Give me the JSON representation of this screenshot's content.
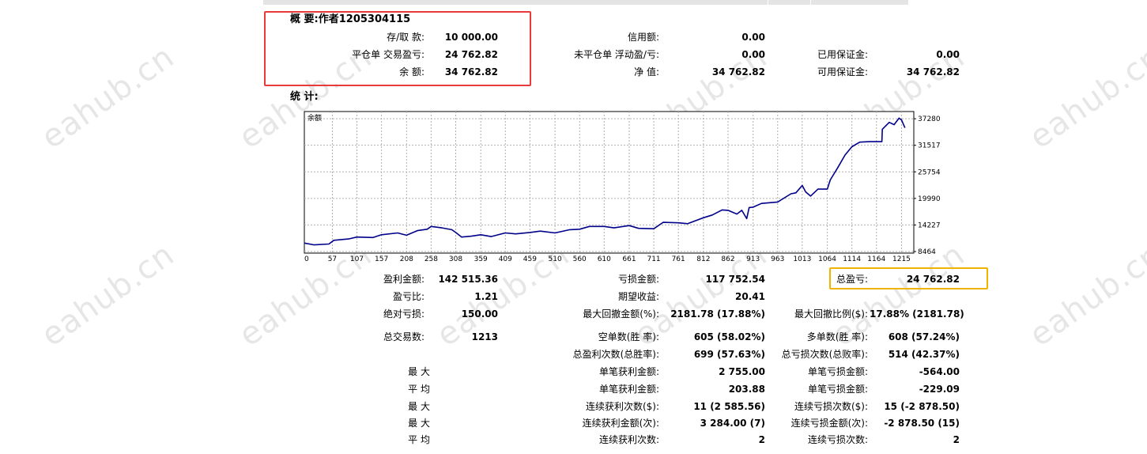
{
  "watermark": "eahub.cn",
  "summary": {
    "title": "概 要:作者1205304115",
    "rows": [
      {
        "l1": "存/取 款:",
        "v1": "10 000.00",
        "l2": "信用额:",
        "v2": "0.00",
        "l3": "",
        "v3": ""
      },
      {
        "l1": "平仓单 交易盈亏:",
        "v1": "24 762.82",
        "l2": "未平仓单 浮动盈/亏:",
        "v2": "0.00",
        "l3": "已用保证金:",
        "v3": "0.00"
      },
      {
        "l1": "余 额:",
        "v1": "34 762.82",
        "l2": "净 值:",
        "v2": "34 762.82",
        "l3": "可用保证金:",
        "v3": "34 762.82"
      }
    ]
  },
  "stats_title": "统 计:",
  "chart_data": {
    "type": "line",
    "title": "余额",
    "x": [
      0,
      57,
      107,
      157,
      208,
      258,
      308,
      359,
      409,
      459,
      510,
      560,
      610,
      661,
      711,
      761,
      812,
      862,
      913,
      963,
      1013,
      1064,
      1114,
      1164,
      1215
    ],
    "xlim": [
      0,
      1240
    ],
    "ylim": [
      8464,
      38500
    ],
    "y_ticks": [
      37280,
      31517,
      25754,
      19990,
      14227,
      8464
    ],
    "grid": true,
    "series": [
      {
        "color": "#00008b",
        "points": [
          [
            0,
            10300
          ],
          [
            20,
            9900
          ],
          [
            50,
            10100
          ],
          [
            60,
            10900
          ],
          [
            90,
            11200
          ],
          [
            107,
            11600
          ],
          [
            140,
            11500
          ],
          [
            157,
            12100
          ],
          [
            190,
            12500
          ],
          [
            208,
            12000
          ],
          [
            230,
            13000
          ],
          [
            250,
            13300
          ],
          [
            258,
            13900
          ],
          [
            280,
            13600
          ],
          [
            300,
            13200
          ],
          [
            308,
            12600
          ],
          [
            320,
            11600
          ],
          [
            340,
            11800
          ],
          [
            359,
            12100
          ],
          [
            380,
            11700
          ],
          [
            409,
            12500
          ],
          [
            430,
            12300
          ],
          [
            459,
            12600
          ],
          [
            480,
            12900
          ],
          [
            510,
            12500
          ],
          [
            540,
            13200
          ],
          [
            560,
            13300
          ],
          [
            580,
            13900
          ],
          [
            610,
            13900
          ],
          [
            630,
            13600
          ],
          [
            661,
            14100
          ],
          [
            680,
            13500
          ],
          [
            711,
            13400
          ],
          [
            730,
            14800
          ],
          [
            761,
            14700
          ],
          [
            780,
            14500
          ],
          [
            812,
            15800
          ],
          [
            830,
            16400
          ],
          [
            850,
            17500
          ],
          [
            862,
            17400
          ],
          [
            880,
            16600
          ],
          [
            890,
            17400
          ],
          [
            900,
            15600
          ],
          [
            905,
            18000
          ],
          [
            913,
            18100
          ],
          [
            930,
            18900
          ],
          [
            963,
            19200
          ],
          [
            990,
            21000
          ],
          [
            1000,
            21200
          ],
          [
            1013,
            22800
          ],
          [
            1020,
            21400
          ],
          [
            1030,
            20500
          ],
          [
            1045,
            22000
          ],
          [
            1064,
            22000
          ],
          [
            1070,
            24000
          ],
          [
            1085,
            26600
          ],
          [
            1100,
            29400
          ],
          [
            1114,
            31200
          ],
          [
            1130,
            32200
          ],
          [
            1150,
            32300
          ],
          [
            1164,
            32300
          ],
          [
            1175,
            32300
          ],
          [
            1176,
            35000
          ],
          [
            1190,
            36500
          ],
          [
            1200,
            36000
          ],
          [
            1210,
            37400
          ],
          [
            1215,
            37000
          ],
          [
            1222,
            35300
          ]
        ]
      }
    ]
  },
  "results": {
    "r1": {
      "l1": "盈利金额:",
      "v1": "142 515.36",
      "l2": "亏损金额:",
      "v2": "117 752.54",
      "l3": "总盈亏:",
      "v3": "24 762.82"
    },
    "r2": {
      "l1": "盈亏比:",
      "v1": "1.21",
      "l2": "期望收益:",
      "v2": "20.41"
    },
    "r3": {
      "l1": "绝对亏损:",
      "v1": "150.00",
      "l2": "最大回撤金额(%):",
      "v2": "2181.78 (17.88%)",
      "l3": "最大回撤比例($):",
      "v3": "17.88% (2181.78)"
    },
    "r4": {
      "l1": "总交易数:",
      "v1": "1213",
      "l2": "空单数(胜 率):",
      "v2": "605 (58.02%)",
      "l3": "多单数(胜 率):",
      "v3": "608 (57.24%)"
    },
    "r5": {
      "l2": "总盈利次数(总胜率):",
      "v2": "699 (57.63%)",
      "l3": "总亏损次数(总败率):",
      "v3": "514 (42.37%)"
    },
    "r6": {
      "l1": "最 大",
      "l2": "单笔获利金额:",
      "v2": "2 755.00",
      "l3": "单笔亏损金额:",
      "v3": "-564.00"
    },
    "r7": {
      "l1": "平 均",
      "l2": "单笔获利金额:",
      "v2": "203.88",
      "l3": "单笔亏损金额:",
      "v3": "-229.09"
    },
    "r8": {
      "l1": "最 大",
      "l2": "连续获利次数($):",
      "v2": "11 (2 585.56)",
      "l3": "连续亏损次数($):",
      "v3": "15 (-2 878.50)"
    },
    "r9": {
      "l1": "最 大",
      "l2": "连续获利金额(次):",
      "v2": "3 284.00 (7)",
      "l3": "连续亏损金额(次):",
      "v3": "-2 878.50 (15)"
    },
    "r10": {
      "l1": "平 均",
      "l2": "连续获利次数:",
      "v2": "2",
      "l3": "连续亏损次数:",
      "v3": "2"
    }
  }
}
